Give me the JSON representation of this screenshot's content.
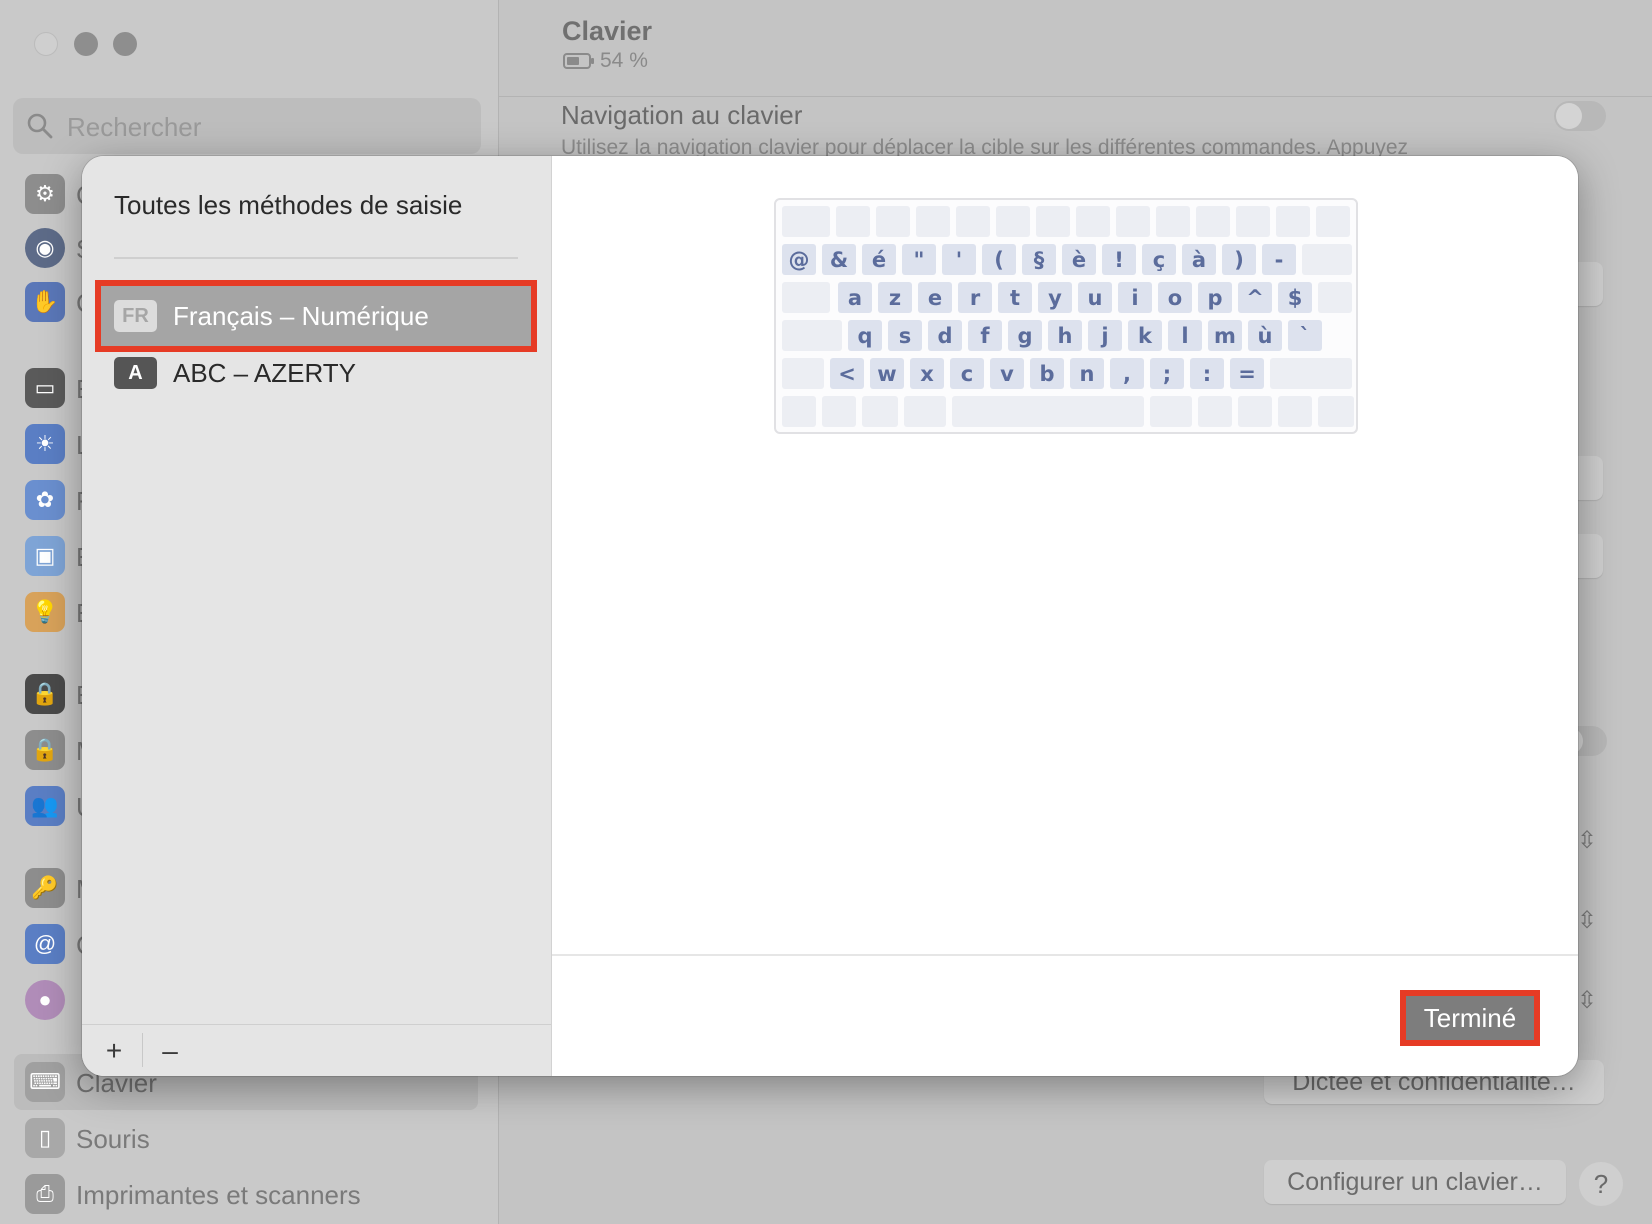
{
  "sidebar": {
    "search_placeholder": "Rechercher",
    "visible_items": [
      {
        "icon": "keyboard-icon",
        "label": "Clavier",
        "selected": true
      },
      {
        "icon": "mouse-icon",
        "label": "Souris"
      },
      {
        "icon": "printer-icon",
        "label": "Imprimantes et scanners"
      }
    ],
    "partial_letters": [
      "C",
      "S",
      "C",
      "E",
      "L",
      "F",
      "E",
      "E",
      "E",
      "M",
      "U",
      "M",
      "C"
    ]
  },
  "main": {
    "title": "Clavier",
    "battery": "54 %",
    "nav_title": "Navigation au clavier",
    "nav_description": "Utilisez la navigation clavier pour déplacer la cible sur les différentes commandes. Appuyez",
    "dictation_button": "Dictée et confidentialité…",
    "configure_button": "Configurer un clavier…",
    "help_button": "?"
  },
  "sheet": {
    "left_title": "Toutes les méthodes de saisie",
    "methods": [
      {
        "badge": "FR",
        "label": "Français – Numérique",
        "selected": true
      },
      {
        "badge": "A",
        "label": "ABC – AZERTY",
        "selected": false
      }
    ],
    "add_button": "+",
    "remove_button": "–",
    "done_button": "Terminé",
    "highlight_color": "#e63b25",
    "keyboard_rows": [
      [
        "@",
        "&",
        "é",
        "\"",
        "'",
        "(",
        "§",
        "è",
        "!",
        "ç",
        "à",
        ")",
        "-"
      ],
      [
        "a",
        "z",
        "e",
        "r",
        "t",
        "y",
        "u",
        "i",
        "o",
        "p",
        "^",
        "$"
      ],
      [
        "q",
        "s",
        "d",
        "f",
        "g",
        "h",
        "j",
        "k",
        "l",
        "m",
        "ù",
        "`"
      ],
      [
        "<",
        "w",
        "x",
        "c",
        "v",
        "b",
        "n",
        ",",
        ";",
        ":",
        "="
      ]
    ]
  }
}
